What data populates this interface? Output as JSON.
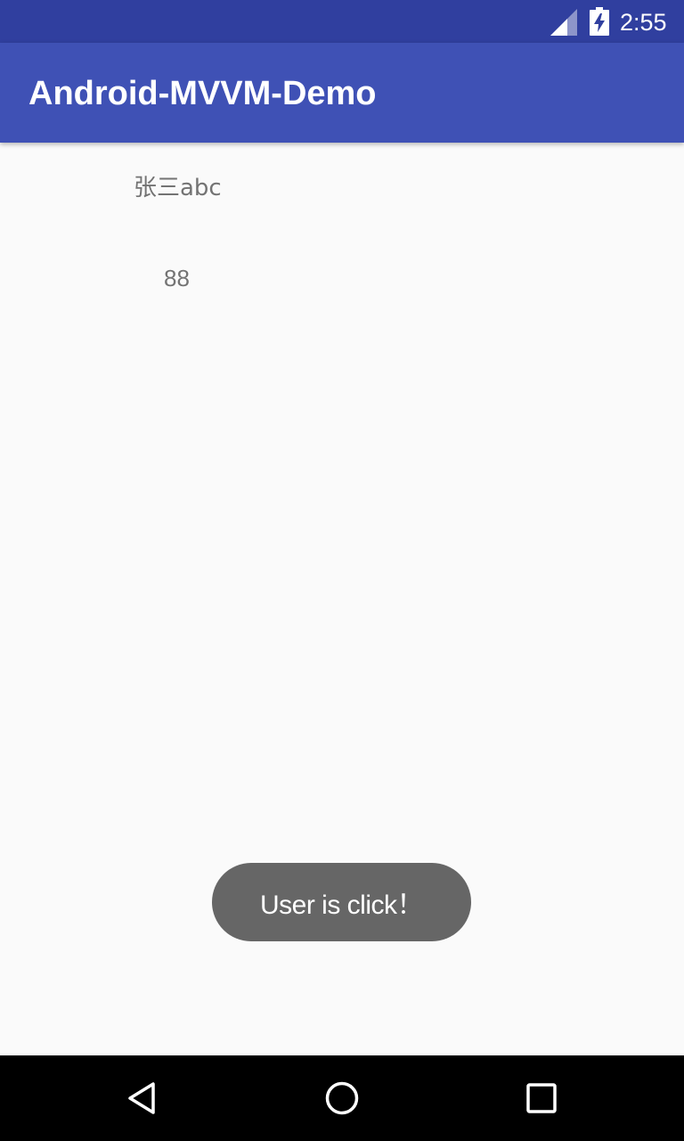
{
  "status_bar": {
    "time": "2:55",
    "icons": [
      "signal-icon",
      "battery-charging-icon"
    ],
    "color": "#303f9f"
  },
  "app_bar": {
    "title": "Android-MVVM-Demo",
    "color": "#3f51b5"
  },
  "user": {
    "name": "张三abc",
    "age": "88"
  },
  "toast": {
    "message": "User is click！"
  },
  "nav_bar": {
    "buttons": [
      "back-icon",
      "home-icon",
      "recents-icon"
    ]
  },
  "colors": {
    "background": "#fafafa",
    "text_secondary": "#737373",
    "toast_bg": "#666666"
  }
}
